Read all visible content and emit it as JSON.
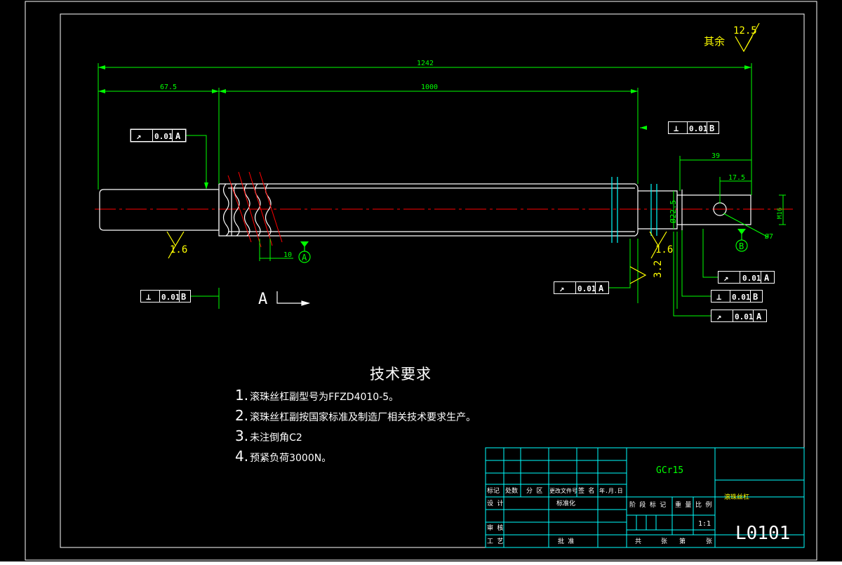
{
  "drawing": {
    "dims": {
      "overall": "1242",
      "left_end": "67.5",
      "thread_len": "1000",
      "right_end": "39",
      "hole_pos": "17.5",
      "thread_step": "10",
      "dia": "Ø22.5",
      "m16": "M16",
      "hole": "Ø7"
    },
    "roughness": {
      "other_label": "其余",
      "other": "12.5",
      "left": "1.6",
      "right": "1.6",
      "bearing": "3.2"
    },
    "tolerances": [
      {
        "symbol": "↗",
        "value": "0.01",
        "datum": "A"
      },
      {
        "symbol": "⊥",
        "value": "0.01",
        "datum": "B"
      },
      {
        "symbol": "⊥",
        "value": "0.01",
        "datum": "B"
      },
      {
        "symbol": "↗",
        "value": "0.01",
        "datum": "A"
      },
      {
        "symbol": "↗",
        "value": "0.01",
        "datum": "A"
      },
      {
        "symbol": "⊥",
        "value": "0.01",
        "datum": "B"
      },
      {
        "symbol": "↗",
        "value": "0.01",
        "datum": "A"
      }
    ],
    "datums": {
      "a": "A",
      "b": "B"
    },
    "section_label": "A"
  },
  "tech_requirements": {
    "title": "技术要求",
    "items": [
      {
        "num": "1.",
        "text": "滚珠丝杠副型号为FFZD4010-5。"
      },
      {
        "num": "2.",
        "text": "滚珠丝杠副按国家标准及制造厂相关技术要求生产。"
      },
      {
        "num": "3.",
        "text": "未注倒角C2"
      },
      {
        "num": "4.",
        "text": "预紧负荷3000N。"
      }
    ]
  },
  "title_block": {
    "material": "GCr15",
    "part_name": "滚珠丝杠",
    "scale": "1:1",
    "drawing_no": "L0101",
    "labels": {
      "mark": "标记",
      "count": "处数",
      "zone": "分 区",
      "change_doc": "更改文件号",
      "sign": "签 名",
      "date": "年.月.日",
      "design": "设 计",
      "standard": "标准化",
      "stage_mark": "阶 段 标 记",
      "weight": "重 量",
      "scale": "比 例",
      "review": "审 核",
      "process": "工 艺",
      "approve": "批 准",
      "sheets_total": "共",
      "sheet": "张",
      "sheet_no": "第",
      "sheet2": "张"
    }
  },
  "colors": {
    "background": "#000000",
    "outline": "#ffffff",
    "dimension": "#00ff00",
    "centerline": "#ff0000",
    "hatch": "#ff0000",
    "table": "#00ffff",
    "datum": "#00ff00",
    "roughness": "#ffff00"
  }
}
